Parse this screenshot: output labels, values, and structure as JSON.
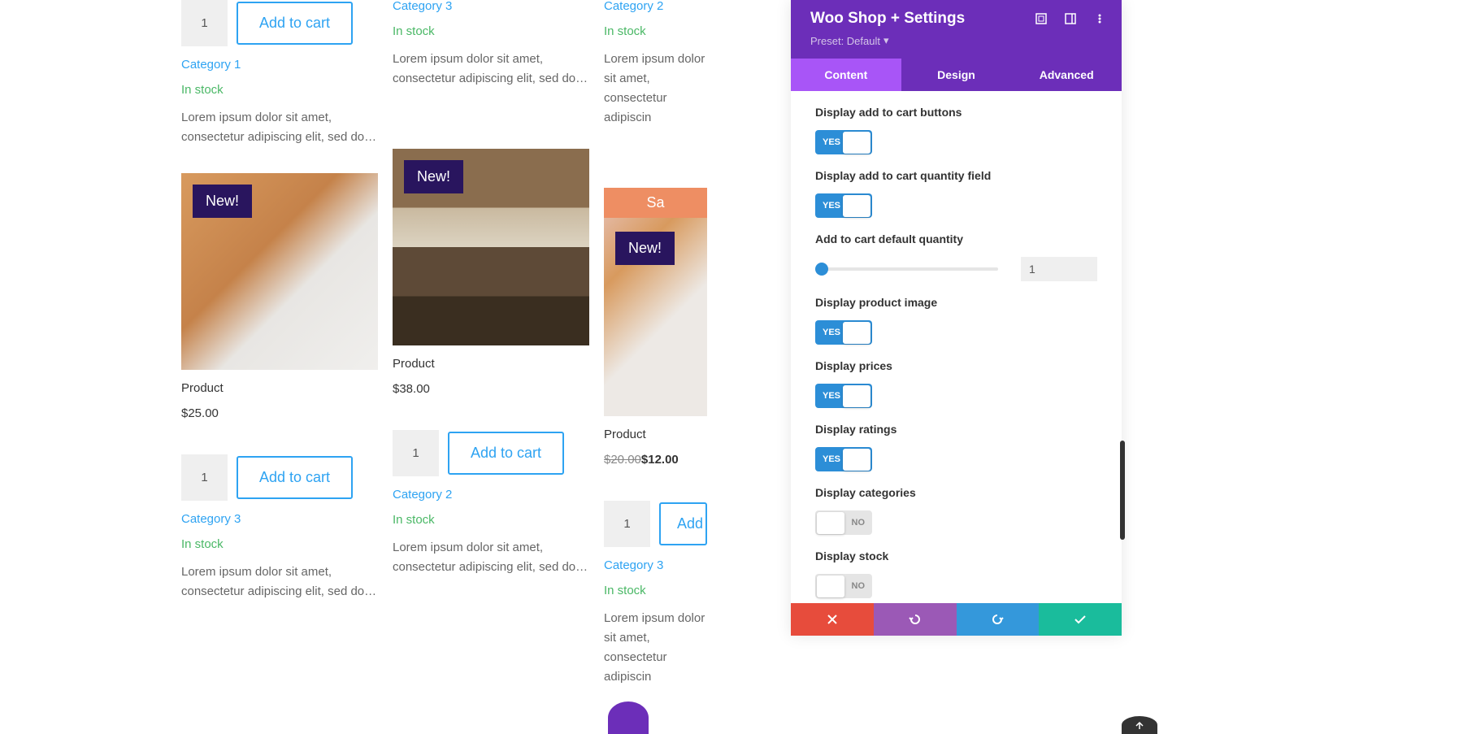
{
  "common": {
    "qtyValue": "1",
    "addToCart": "Add to cart",
    "inStock": "In stock",
    "lorem": "Lorem ipsum dolor sit amet, consectetur adipiscing elit, sed do…",
    "loremShort": "Lorem ipsum dolor sit amet, consectetur adipiscin",
    "productTitle": "Product",
    "newBadge": "New!",
    "saleBanner": "Sa",
    "addShort": "Add"
  },
  "col1": {
    "top": {
      "category": "Category 1"
    },
    "bottom": {
      "price": "$25.00",
      "category": "Category 3"
    }
  },
  "col2": {
    "top": {
      "category": "Category 3"
    },
    "bottom": {
      "price": "$38.00",
      "category": "Category 2"
    }
  },
  "col3": {
    "top": {
      "category": "Category 2"
    },
    "bottom": {
      "priceOld": "$20.00",
      "priceNew": "$12.00",
      "category": "Category 3"
    }
  },
  "panel": {
    "title": "Woo Shop + Settings",
    "preset": "Preset: Default",
    "tabs": {
      "content": "Content",
      "design": "Design",
      "advanced": "Advanced"
    },
    "settings": {
      "addCartButtons": {
        "label": "Display add to cart buttons",
        "value": "YES"
      },
      "addCartQty": {
        "label": "Display add to cart quantity field",
        "value": "YES"
      },
      "defaultQty": {
        "label": "Add to cart default quantity",
        "value": "1"
      },
      "productImage": {
        "label": "Display product image",
        "value": "YES"
      },
      "prices": {
        "label": "Display prices",
        "value": "YES"
      },
      "ratings": {
        "label": "Display ratings",
        "value": "YES"
      },
      "categories": {
        "label": "Display categories",
        "value": "NO"
      },
      "stock": {
        "label": "Display stock",
        "value": "NO"
      }
    }
  }
}
